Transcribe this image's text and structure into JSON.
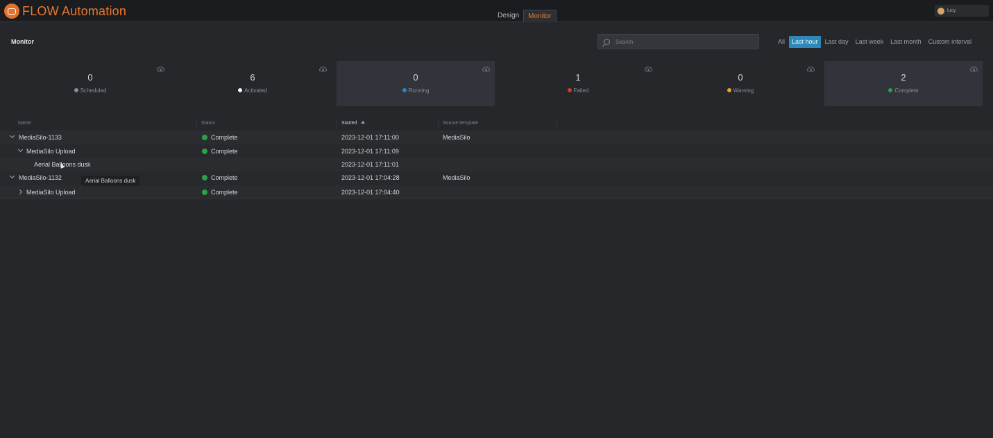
{
  "app": {
    "title": "FLOW Automation",
    "user": "lucy"
  },
  "nav": {
    "tabs": [
      {
        "label": "Design"
      },
      {
        "label": "Monitor"
      }
    ],
    "active": "Monitor"
  },
  "page": {
    "title": "Monitor"
  },
  "search": {
    "placeholder": "Search",
    "value": ""
  },
  "filters": [
    {
      "label": "All"
    },
    {
      "label": "Last hour",
      "active": true
    },
    {
      "label": "Last day"
    },
    {
      "label": "Last week"
    },
    {
      "label": "Last month"
    },
    {
      "label": "Custom interval"
    }
  ],
  "stats": [
    {
      "value": "0",
      "label": "Scheduled",
      "color": "#8a8e95"
    },
    {
      "value": "6",
      "label": "Activated",
      "color": "#f2f2f2"
    },
    {
      "value": "0",
      "label": "Running",
      "color": "#2e88b8"
    },
    {
      "value": "1",
      "label": "Failed",
      "color": "#d23b2f"
    },
    {
      "value": "0",
      "label": "Warning",
      "color": "#e3a726"
    },
    {
      "value": "2",
      "label": "Complete",
      "color": "#2aa14b"
    }
  ],
  "table": {
    "columns": {
      "name": "Name",
      "status": "Status",
      "started": "Started",
      "source": "Source template"
    },
    "rows": [
      {
        "name": "MediaSilo-1133",
        "status": "Complete",
        "started": "2023-12-01 17:11:00",
        "source": "MediaSilo"
      },
      {
        "name": "MediaSilo Upload",
        "status": "Complete",
        "started": "2023-12-01 17:11:09",
        "source": ""
      },
      {
        "name": "Aerial Balloons dusk",
        "status": "",
        "started": "2023-12-01 17:11:01",
        "source": ""
      },
      {
        "name": "MediaSilo-1132",
        "status": "Complete",
        "started": "2023-12-01 17:04:28",
        "source": "MediaSilo"
      },
      {
        "name": "MediaSilo Upload",
        "status": "Complete",
        "started": "2023-12-01 17:04:40",
        "source": ""
      }
    ]
  },
  "tooltip": {
    "text": "Aerial Balloons dusk"
  }
}
